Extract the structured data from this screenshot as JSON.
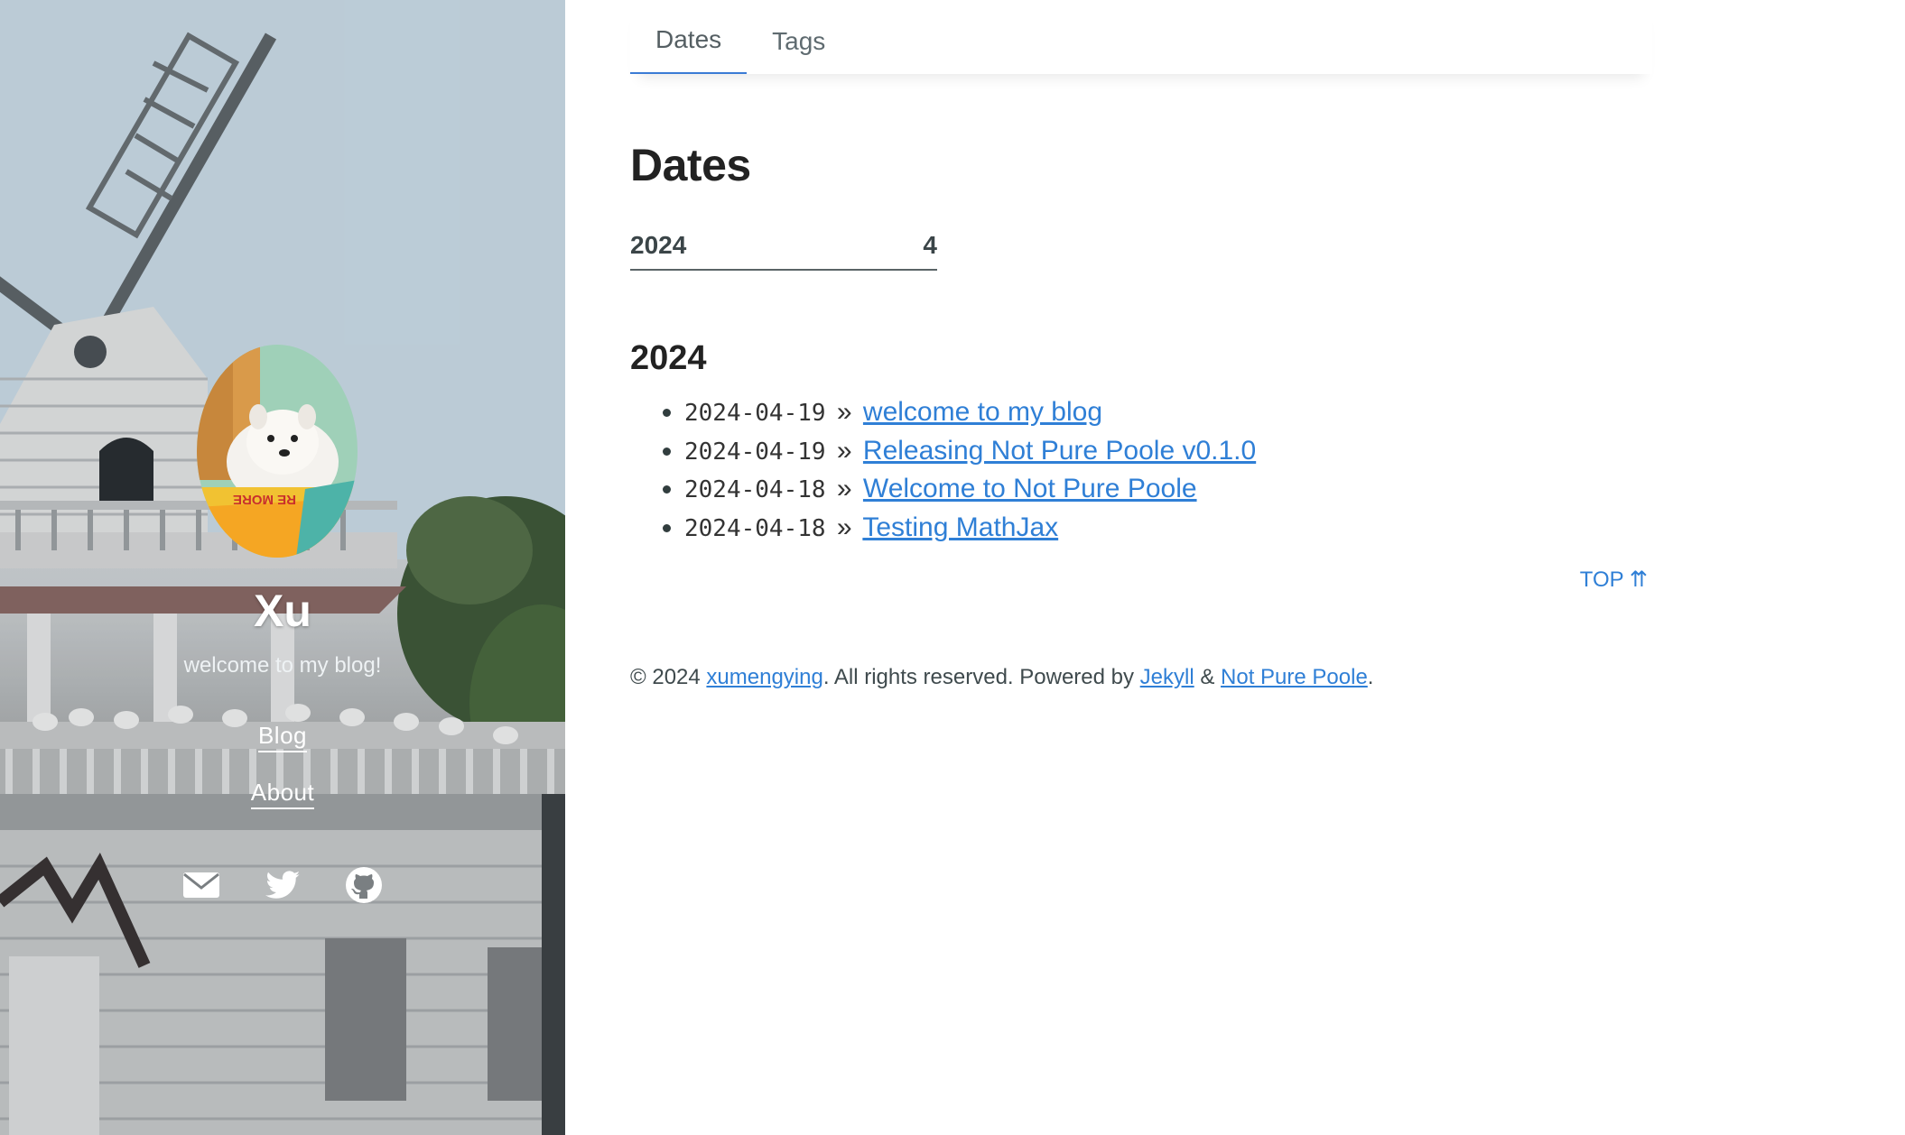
{
  "sidebar": {
    "title": "Xu",
    "description": "welcome to my blog!",
    "nav": [
      {
        "label": "Blog"
      },
      {
        "label": "About"
      }
    ],
    "social": [
      {
        "icon": "envelope-icon"
      },
      {
        "icon": "twitter-icon"
      },
      {
        "icon": "github-icon"
      }
    ],
    "avatar_text": "RE MORE"
  },
  "tabs": [
    {
      "label": "Dates",
      "active": true
    },
    {
      "label": "Tags",
      "active": false
    }
  ],
  "page": {
    "title": "Dates",
    "summary": {
      "year": "2024",
      "count": "4"
    },
    "year_heading": "2024",
    "posts": [
      {
        "date": "2024-04-19",
        "sep": "»",
        "title": "welcome to my blog"
      },
      {
        "date": "2024-04-19",
        "sep": "»",
        "title": "Releasing Not Pure Poole v0.1.0"
      },
      {
        "date": "2024-04-18",
        "sep": "»",
        "title": "Welcome to Not Pure Poole"
      },
      {
        "date": "2024-04-18",
        "sep": "»",
        "title": "Testing MathJax"
      }
    ],
    "top_link": "TOP ⇈"
  },
  "footer": {
    "prefix": "© 2024 ",
    "author": "xumengying",
    "middle": ". All rights reserved. Powered by ",
    "jekyll": "Jekyll",
    "amp": " & ",
    "theme": "Not Pure Poole",
    "suffix": "."
  },
  "colors": {
    "link": "#2f7fd6",
    "tab_underline": "#3a7bd5",
    "text": "#313d3e"
  }
}
